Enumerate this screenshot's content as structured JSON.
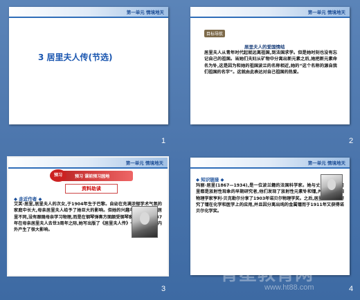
{
  "header_label": "第一单元 情境地天",
  "slides": [
    {
      "number": "1",
      "title": "3 居里夫人传(节选)"
    },
    {
      "number": "2",
      "badge": "目标导航",
      "subhead": "居里夫人的爱国情结",
      "body": "居里夫人从青年时代起就远离祖国,到法国求学。但是她时刻也没有忘记自己的祖国。当她们夫妇从矿物中分离出新元素之后,她把新元素命名为钋,这是因为和她的祖国波兰的名称相近,她的“这个名称的源自我们祖国的名字”。这就由此表达对自己祖国的热爱。"
    },
    {
      "number": "3",
      "banner": "预习 课前预习园地",
      "zl_label": "资料助读",
      "bullet": "◆ 走近作者 ◆",
      "body": "艾芙·居里,居里夫人的次女,于1904年生于巴黎。自幼在充满浓郁学术气氛的家庭中长大,母亲居里夫人给予了她巨大的影响。但她的兴趣与姐姐伊雷娜·居里不同,没有跟随母亲学习物理,而是在钢琴弹奏方面颇受钢琴家的赞赏。1937年在母亲居里夫人去世3周年之际,她写出版了《居里夫人传》一书,在法国国内外产生了很大影响。"
    },
    {
      "number": "4",
      "bullet": "◆ 知识链接 ◆",
      "body": "玛丽·居里(1867—1934),是一位波兰籍的法国科学家。她与丈夫比埃尔·居里都是放射性现象的早期研究者,他们发现了放射性元素钋和镭,并因此与法国物理学家亨利·贝克勒尔分享了1903年诺贝尔物理学奖。之后,居里夫人继续研究了镭在化学和医学上的应用,并且因分离出纯的金属镭而于1911年又获得诺贝尔化学奖。"
    }
  ],
  "watermark": "育星教育网",
  "watermark_url": "www.ht88.com"
}
